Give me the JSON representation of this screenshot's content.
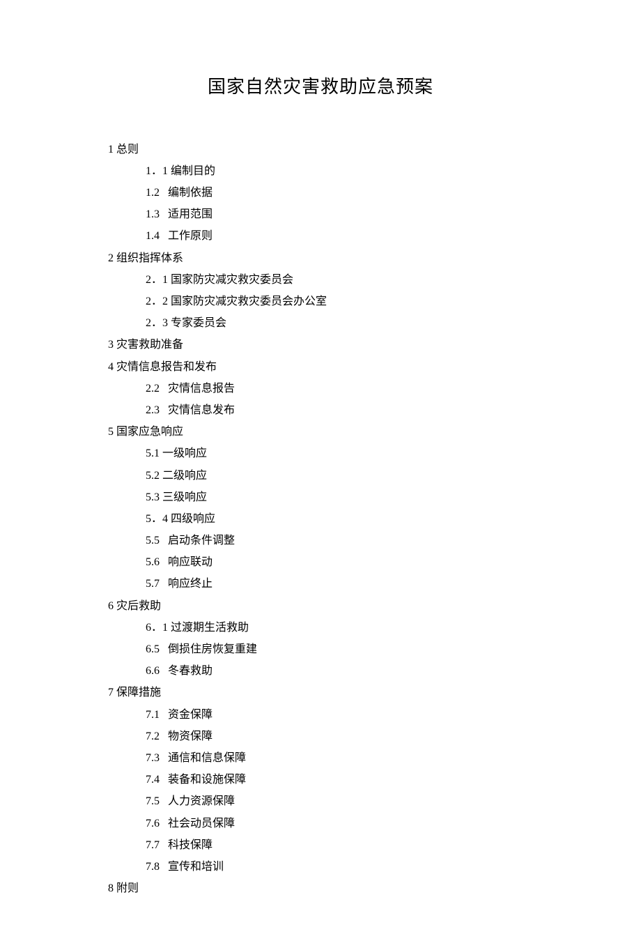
{
  "title": "国家自然灾害救助应急预案",
  "toc": [
    {
      "level": 1,
      "text": "1 总则"
    },
    {
      "level": 2,
      "text": "1．1 编制目的"
    },
    {
      "level": 2,
      "text": "1.2   编制依据"
    },
    {
      "level": 2,
      "text": "1.3   适用范围"
    },
    {
      "level": 2,
      "text": "1.4   工作原则"
    },
    {
      "level": 1,
      "text": "2 组织指挥体系"
    },
    {
      "level": 2,
      "text": "2．1 国家防灾减灾救灾委员会"
    },
    {
      "level": 2,
      "text": "2．2 国家防灾减灾救灾委员会办公室"
    },
    {
      "level": 2,
      "text": "2．3 专家委员会"
    },
    {
      "level": 1,
      "text": "3 灾害救助准备"
    },
    {
      "level": 1,
      "text": "4 灾情信息报告和发布"
    },
    {
      "level": 2,
      "text": "2.2   灾情信息报告"
    },
    {
      "level": 2,
      "text": "2.3   灾情信息发布"
    },
    {
      "level": 1,
      "text": "5 国家应急响应"
    },
    {
      "level": 2,
      "text": "5.1 一级响应"
    },
    {
      "level": 2,
      "text": "5.2 二级响应"
    },
    {
      "level": 2,
      "text": "5.3 三级响应"
    },
    {
      "level": 2,
      "text": "5．4 四级响应"
    },
    {
      "level": 2,
      "text": "5.5   启动条件调整"
    },
    {
      "level": 2,
      "text": "5.6   响应联动"
    },
    {
      "level": 2,
      "text": "5.7   响应终止"
    },
    {
      "level": 1,
      "text": "6 灾后救助"
    },
    {
      "level": 2,
      "text": "6．1 过渡期生活救助"
    },
    {
      "level": 2,
      "text": "6.5   倒损住房恢复重建"
    },
    {
      "level": 2,
      "text": "6.6   冬春救助"
    },
    {
      "level": 1,
      "text": "7 保障措施"
    },
    {
      "level": 2,
      "text": "7.1   资金保障"
    },
    {
      "level": 2,
      "text": "7.2   物资保障"
    },
    {
      "level": 2,
      "text": "7.3   通信和信息保障"
    },
    {
      "level": 2,
      "text": "7.4   装备和设施保障"
    },
    {
      "level": 2,
      "text": "7.5   人力资源保障"
    },
    {
      "level": 2,
      "text": "7.6   社会动员保障"
    },
    {
      "level": 2,
      "text": "7.7   科技保障"
    },
    {
      "level": 2,
      "text": "7.8   宣传和培训"
    },
    {
      "level": 1,
      "text": "8 附则"
    }
  ]
}
